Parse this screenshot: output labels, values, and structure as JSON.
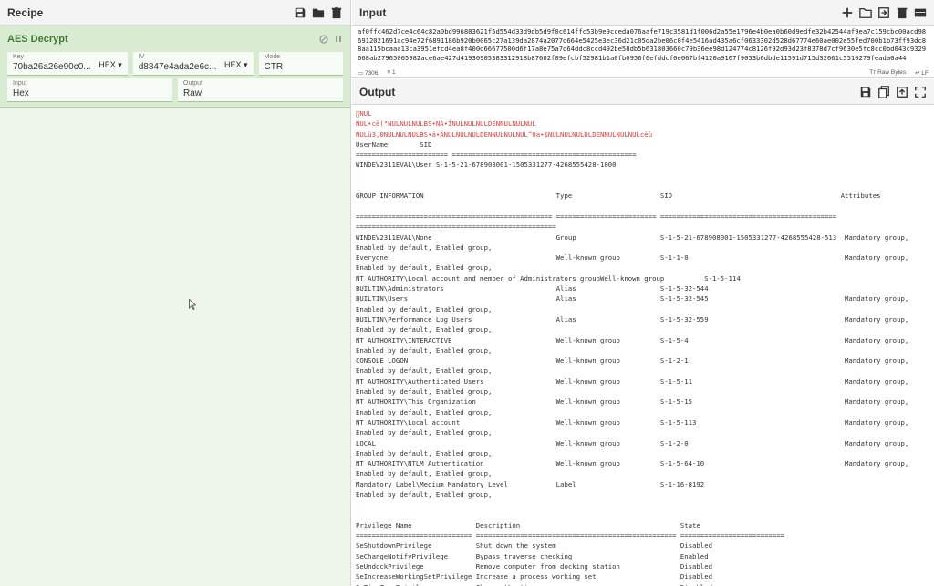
{
  "recipe": {
    "title": "Recipe",
    "icons": [
      "save-icon",
      "folder-icon",
      "trash-icon"
    ],
    "operation": {
      "name": "AES Decrypt",
      "key": {
        "label": "Key",
        "value": "70ba26a26e90c0...",
        "encoding": "HEX"
      },
      "iv": {
        "label": "IV",
        "value": "d8847e4ada2e6c...",
        "encoding": "HEX"
      },
      "mode": {
        "label": "Mode",
        "value": "CTR"
      },
      "input": {
        "label": "Input",
        "value": "Hex"
      },
      "output": {
        "label": "Output",
        "value": "Raw"
      }
    }
  },
  "input": {
    "title": "Input",
    "text": "af0ffc462d7ce4c64c82a0bd996883621f5d554d33d9db5d9f0c614ffc53b9e9cceda076aafe719c3581d1f006d2a55e1796e4b0ea0b60d9edfe32b42544af9ea7c159cbc00acd986912021691ac94e72f6891186b920b0065c27a139da2874a2077d664e5425e3ec36d21c05da2be06c0f4e5416ad435a6cf0633302d528d67774e60ae002e55fed700b1b73ff93dc88aa115bcaaa13ca3951efcd4ea8f400d66677500d6f17a8e75a7d64ddc8ccd492be58db5b631803660c79b36ee98d124774c8126f92d93d23f8378d7cf9630e5fc8cc0bd043c9329668ab27965005982ace6ae427d41930905383312918b87602f09efcbf52981b1a0fb0956f6efddcf0e067bf4120a9167f9053b6dbde11591d715d32661c5510279feada0a44",
    "status_chars": "7306",
    "status_lines": "1",
    "raw_bytes": "Raw Bytes",
    "line_ending": "LF"
  },
  "output": {
    "title": "Output",
    "junk_lines": [
      "\u0000NUL",
      "NUL•cè(\"NULNULNULBS•NA•ÍNULNULNULDENNULNULNUL",
      "NULü3,0NULNULNULBS•ä•ÄNULNULNULDENNULNULNUL^0a•$NULNULNULDLDENNULNULNULcèù"
    ],
    "lines": [
      "UserName        SID",
      "======================= ==============================================",
      "WINDEV2311EVAL\\User S-1-5-21-678908001-1505331277-4268555428-1000",
      "",
      "",
      "GROUP INFORMATION                                 Type                      SID                                          Attributes",
      "",
      "================================================= ========================= ============================================ ",
      "==================================================",
      "WINDEV2311EVAL\\None                               Group                     S-1-5-21-678908001-1505331277-4268555428-513  Mandatory group,",
      "Enabled by default, Enabled group,",
      "Everyone                                          Well-known group          S-1-1-0                                       Mandatory group,",
      "Enabled by default, Enabled group,",
      "NT AUTHORITY\\Local account and member of Administrators groupWell-known group          S-1-5-114",
      "BUILTIN\\Administrators                            Alias                     S-1-5-32-544",
      "BUILTIN\\Users                                     Alias                     S-1-5-32-545                                  Mandatory group,",
      "Enabled by default, Enabled group,",
      "BUILTIN\\Performance Log Users                     Alias                     S-1-5-32-559                                  Mandatory group,",
      "Enabled by default, Enabled group,",
      "NT AUTHORITY\\INTERACTIVE                          Well-known group          S-1-5-4                                       Mandatory group,",
      "Enabled by default, Enabled group,",
      "CONSOLE LOGON                                     Well-known group          S-1-2-1                                       Mandatory group,",
      "Enabled by default, Enabled group,",
      "NT AUTHORITY\\Authenticated Users                  Well-known group          S-1-5-11                                      Mandatory group,",
      "Enabled by default, Enabled group,",
      "NT AUTHORITY\\This Organization                    Well-known group          S-1-5-15                                      Mandatory group,",
      "Enabled by default, Enabled group,",
      "NT AUTHORITY\\Local account                        Well-known group          S-1-5-113                                     Mandatory group,",
      "Enabled by default, Enabled group,",
      "LOCAL                                             Well-known group          S-1-2-0                                       Mandatory group,",
      "Enabled by default, Enabled group,",
      "NT AUTHORITY\\NTLM Authentication                  Well-known group          S-1-5-64-10                                   Mandatory group,",
      "Enabled by default, Enabled group,",
      "Mandatory Label\\Medium Mandatory Level            Label                     S-1-16-8192",
      "Enabled by default, Enabled group,",
      "",
      "",
      "Privilege Name                Description                                        State",
      "============================= ================================================== ==========================",
      "SeShutdownPrivilege           Shut down the system                               Disabled",
      "SeChangeNotifyPrivilege       Bypass traverse checking                           Enabled",
      "SeUndockPrivilege             Remove computer from docking station               Disabled",
      "SeIncreaseWorkingSetPrivilege Increase a process working set                     Disabled",
      "SeTimeZonePrivilege           Change the time zone                               Disabled"
    ]
  }
}
